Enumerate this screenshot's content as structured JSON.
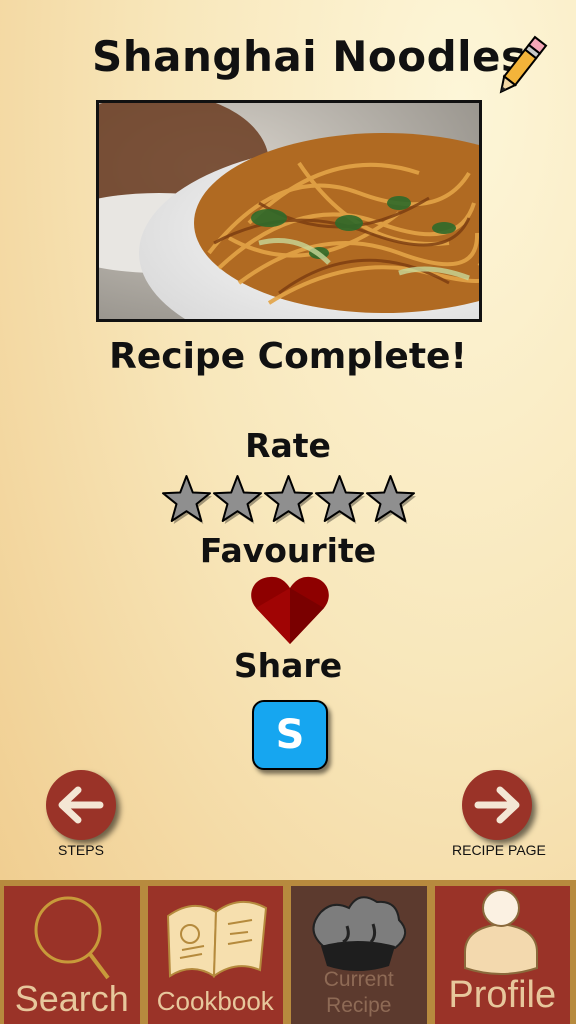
{
  "recipe": {
    "title": "Shanghai Noodles"
  },
  "status": {
    "complete_text": "Recipe Complete!"
  },
  "rating": {
    "label": "Rate",
    "max_stars": 5,
    "value": 0
  },
  "favourite": {
    "label": "Favourite",
    "is_favourite": true
  },
  "share": {
    "label": "Share",
    "button_glyph": "S"
  },
  "navigation": {
    "back_caption": "STEPS",
    "forward_caption": "RECIPE PAGE"
  },
  "tabs": [
    {
      "label": "Search",
      "icon": "search-icon",
      "active": false
    },
    {
      "label": "Cookbook",
      "icon": "book-icon",
      "active": false
    },
    {
      "label": "Current Recipe",
      "label_line1": "Current",
      "label_line2": "Recipe",
      "icon": "chef-hat-icon",
      "active": true
    },
    {
      "label": "Profile",
      "icon": "person-icon",
      "active": false
    }
  ],
  "colors": {
    "accent_red": "#9a3328",
    "tab_active": "#5c3a2e",
    "tab_text": "#e7c79c",
    "heart": "#8e0000",
    "share_blue": "#16a6f0",
    "star_gray": "#8f8f8f"
  }
}
